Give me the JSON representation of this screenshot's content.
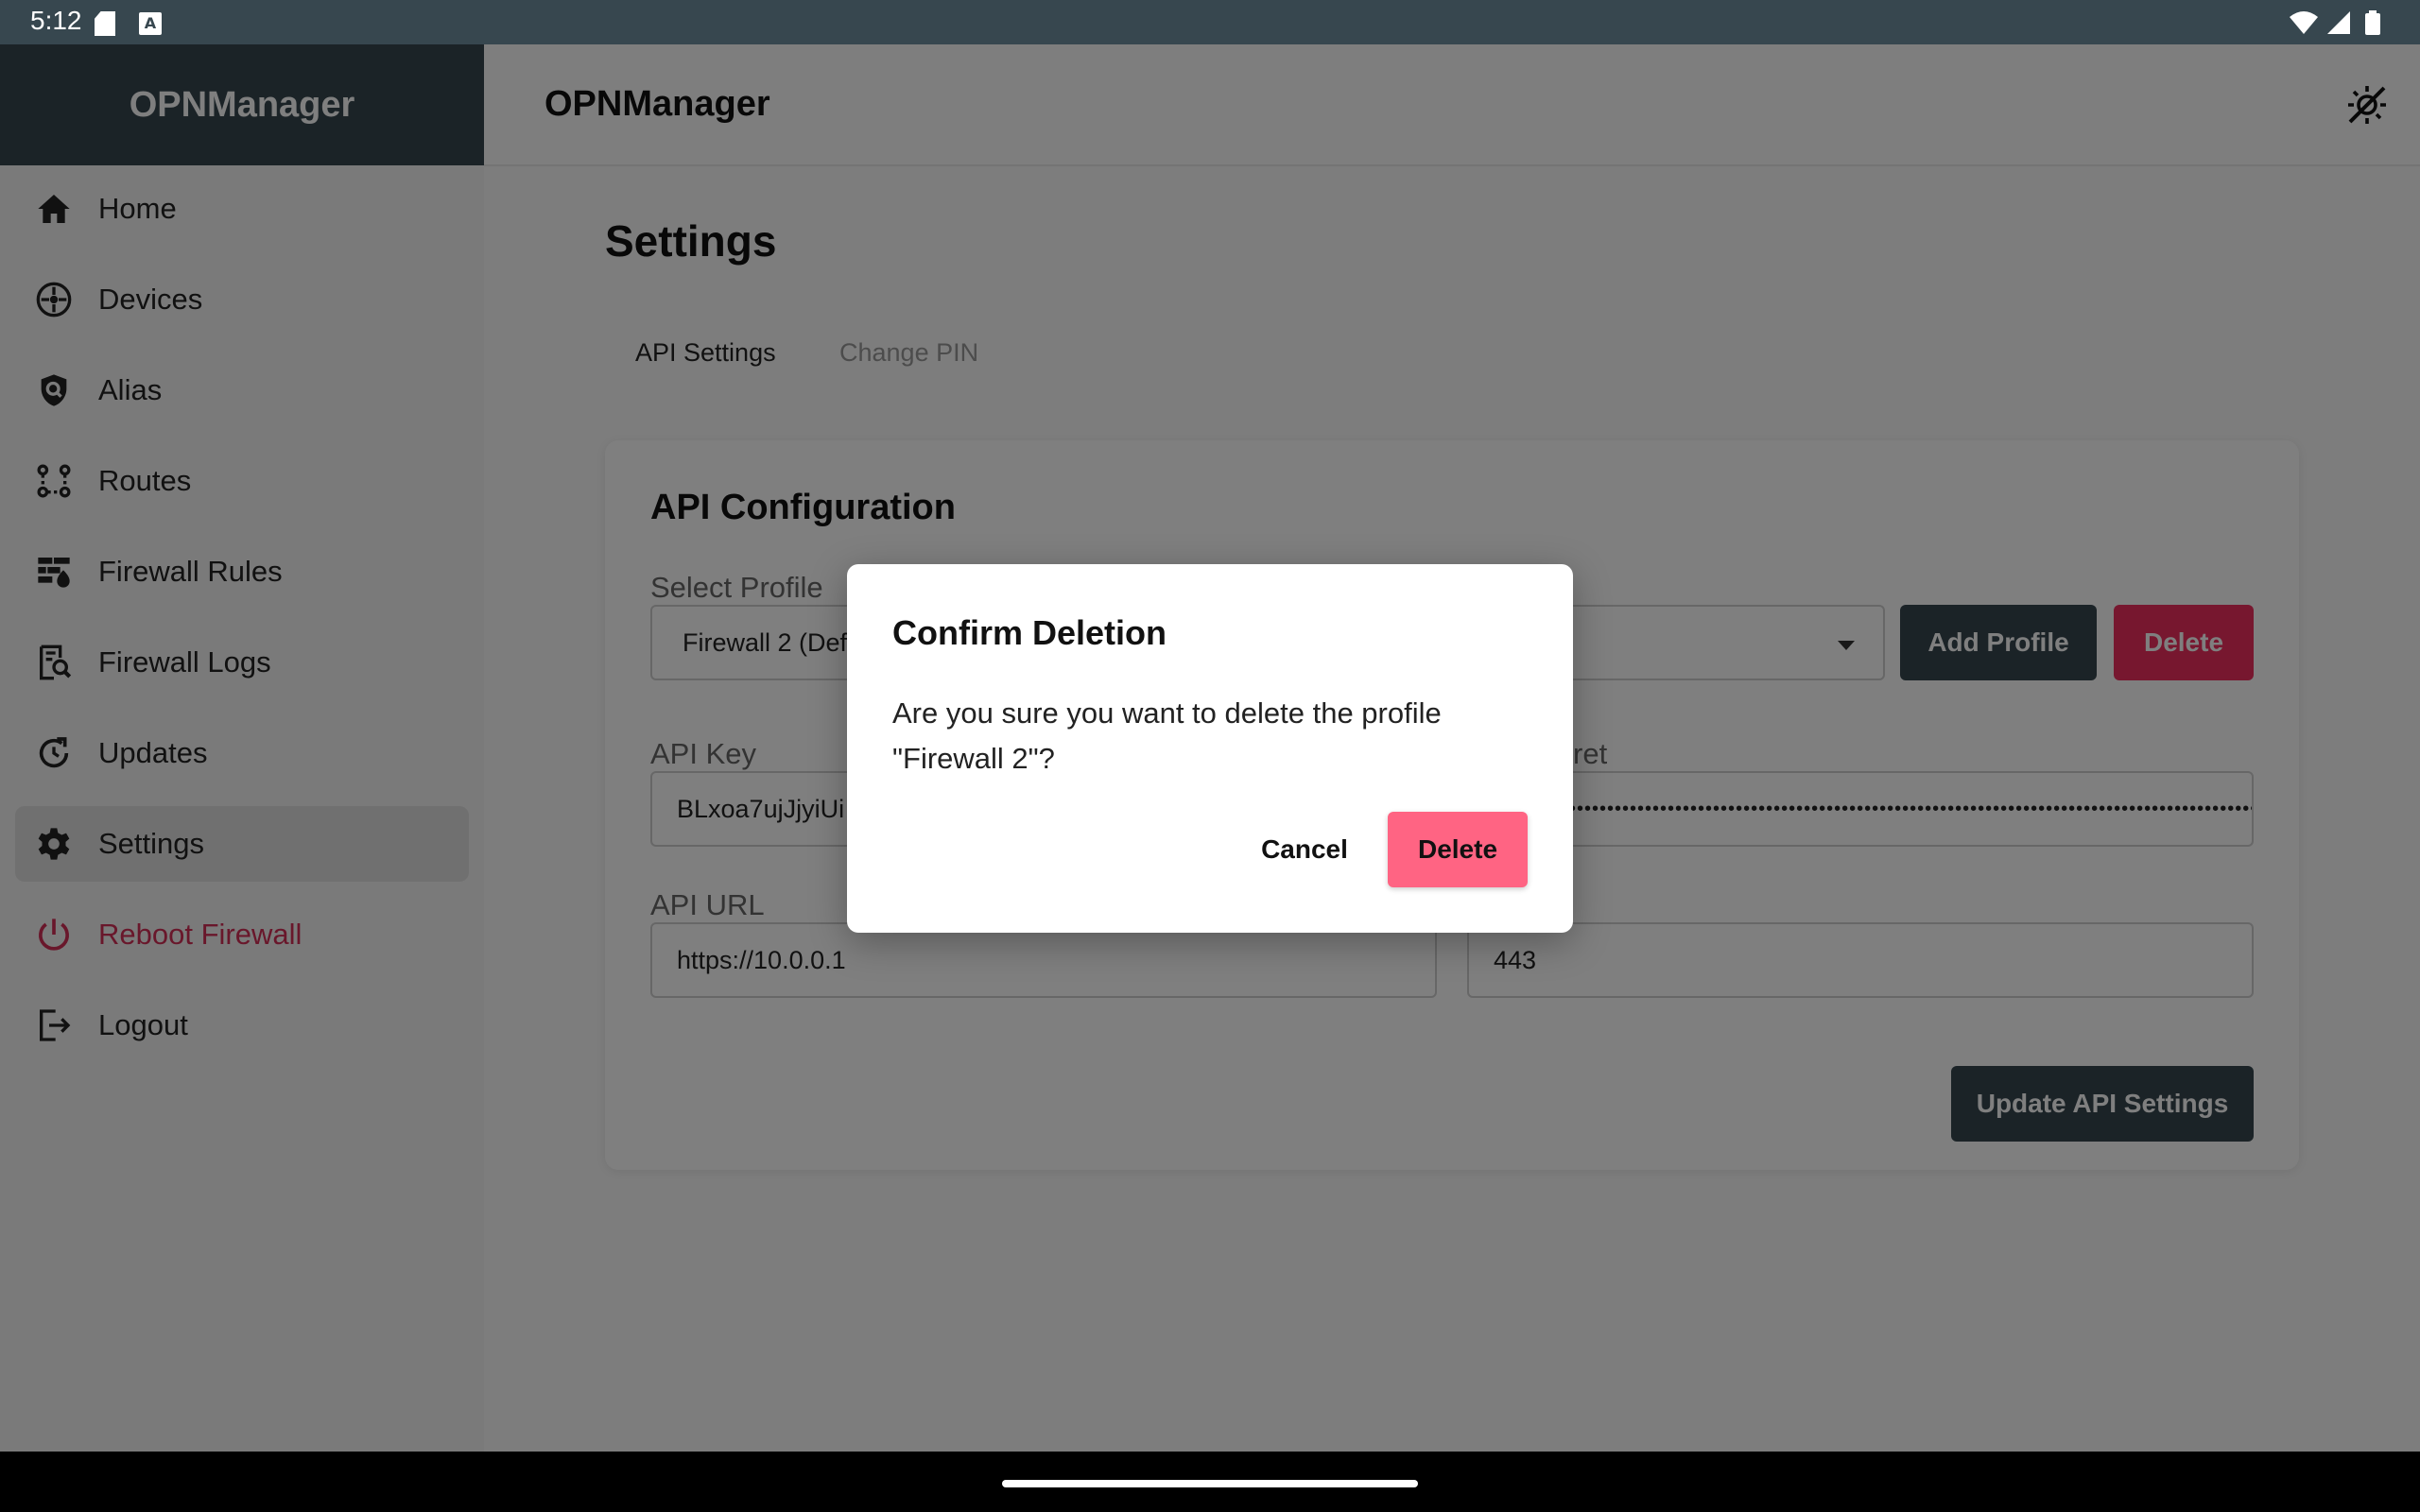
{
  "status_bar": {
    "time": "5:12",
    "notification_icons": [
      "sd-card-icon",
      "a-icon"
    ],
    "system_icons": [
      "wifi-icon",
      "signal-icon",
      "battery-icon"
    ]
  },
  "sidebar": {
    "brand": "OPNManager",
    "items": [
      {
        "label": "Home",
        "icon": "home-icon",
        "active": false
      },
      {
        "label": "Devices",
        "icon": "devices-icon",
        "active": false
      },
      {
        "label": "Alias",
        "icon": "shield-search-icon",
        "active": false
      },
      {
        "label": "Routes",
        "icon": "routes-icon",
        "active": false
      },
      {
        "label": "Firewall Rules",
        "icon": "firewall-rules-icon",
        "active": false
      },
      {
        "label": "Firewall Logs",
        "icon": "firewall-logs-icon",
        "active": false
      },
      {
        "label": "Updates",
        "icon": "updates-icon",
        "active": false
      },
      {
        "label": "Settings",
        "icon": "gear-icon",
        "active": true
      },
      {
        "label": "Reboot Firewall",
        "icon": "power-icon",
        "active": false,
        "color": "#d32f57"
      },
      {
        "label": "Logout",
        "icon": "logout-icon",
        "active": false
      }
    ]
  },
  "appbar": {
    "title": "OPNManager",
    "theme_toggle_icon": "theme-toggle-icon"
  },
  "page": {
    "title": "Settings",
    "tabs": [
      {
        "label": "API Settings",
        "active": true
      },
      {
        "label": "Change PIN",
        "active": false
      }
    ]
  },
  "api_config": {
    "title": "API Configuration",
    "select_profile_label": "Select Profile",
    "selected_profile": "Firewall 2 (Def",
    "add_profile_label": "Add Profile",
    "delete_label": "Delete",
    "api_key_label": "API Key",
    "api_key_value": "BLxoa7ujJjyiUi",
    "api_secret_label": "ret",
    "api_secret_value": "••••••••••••••••••••••••••••••••••••••••••••••••••••••••••••••••••••••••••••••••••••••••••••••••••••••",
    "api_url_label": "API URL",
    "api_url_value": "https://10.0.0.1",
    "port_value": "443",
    "update_label": "Update API Settings"
  },
  "dialog": {
    "title": "Confirm Deletion",
    "message": "Are you sure you want to delete the profile \"Firewall 2\"?",
    "cancel_label": "Cancel",
    "delete_label": "Delete",
    "delete_color": "#ff6483"
  },
  "colors": {
    "primary": "#37474f",
    "danger": "#ef2f5f",
    "reboot": "#d32f57"
  }
}
